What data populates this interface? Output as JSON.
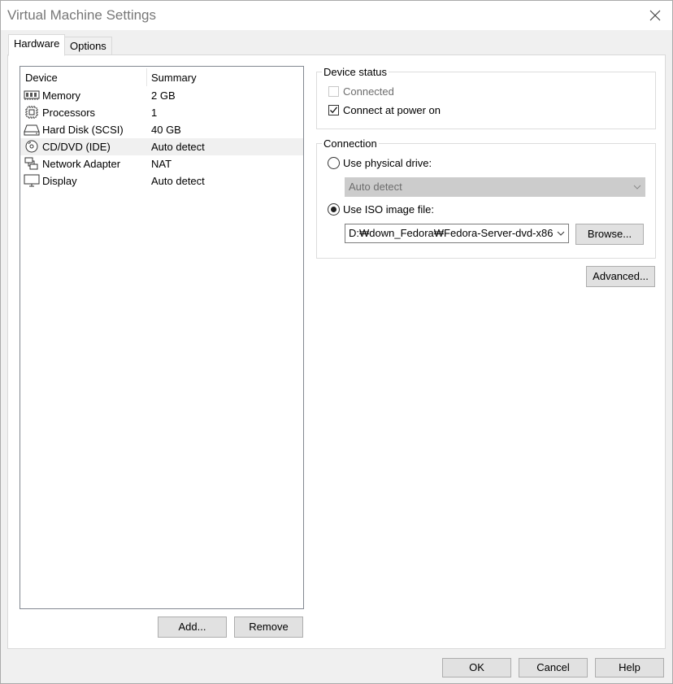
{
  "window": {
    "title": "Virtual Machine Settings"
  },
  "tabs": [
    {
      "label": "Hardware",
      "active": true
    },
    {
      "label": "Options",
      "active": false
    }
  ],
  "device_list": {
    "columns": [
      "Device",
      "Summary"
    ],
    "rows": [
      {
        "icon": "memory-icon",
        "device": "Memory",
        "summary": "2 GB"
      },
      {
        "icon": "processor-icon",
        "device": "Processors",
        "summary": "1"
      },
      {
        "icon": "hard-disk-icon",
        "device": "Hard Disk (SCSI)",
        "summary": "40 GB"
      },
      {
        "icon": "cd-dvd-icon",
        "device": "CD/DVD (IDE)",
        "summary": "Auto detect",
        "selected": true
      },
      {
        "icon": "network-adapter-icon",
        "device": "Network Adapter",
        "summary": "NAT"
      },
      {
        "icon": "display-icon",
        "device": "Display",
        "summary": "Auto detect"
      }
    ]
  },
  "list_buttons": {
    "add": "Add...",
    "remove": "Remove"
  },
  "device_status": {
    "title": "Device status",
    "connected": {
      "label": "Connected",
      "checked": false,
      "enabled": false
    },
    "connect_at_power_on": {
      "label": "Connect at power on",
      "checked": true
    }
  },
  "connection": {
    "title": "Connection",
    "physical_drive": {
      "label": "Use physical drive:",
      "selected": false,
      "value": "Auto detect"
    },
    "iso_image": {
      "label": "Use ISO image file:",
      "selected": true,
      "value": "D:₩down_Fedora₩Fedora-Server-dvd-x86"
    },
    "browse": "Browse..."
  },
  "advanced": "Advanced...",
  "footer": {
    "ok": "OK",
    "cancel": "Cancel",
    "help": "Help"
  }
}
